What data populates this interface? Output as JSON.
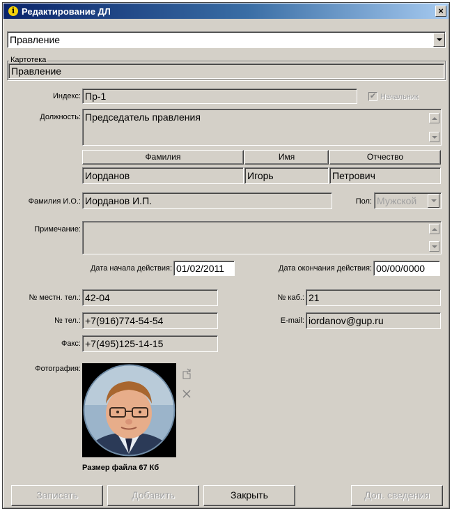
{
  "window": {
    "title": "Редактирование ДЛ",
    "close": "×"
  },
  "top_select": {
    "value": "Правление"
  },
  "kartoteka": {
    "caption": "Картотека",
    "value": "Правление"
  },
  "index": {
    "label": "Индекс:",
    "value": "Пр-1"
  },
  "chief": {
    "label": "Начальник",
    "checked": true,
    "check_mark": "✔"
  },
  "position": {
    "label": "Должность:",
    "value": "Председатель правления"
  },
  "name_headers": {
    "last": "Фамилия",
    "first": "Имя",
    "middle": "Отчество"
  },
  "name_values": {
    "last": "Иорданов",
    "first": "Игорь",
    "middle": "Петрович"
  },
  "short_name": {
    "label": "Фамилия И.О.:",
    "value": "Иорданов И.П."
  },
  "gender": {
    "label": "Пол:",
    "value": "Мужской"
  },
  "note": {
    "label": "Примечание:",
    "value": ""
  },
  "date_start": {
    "label": "Дата начала действия:",
    "value": "01/02/2011"
  },
  "date_end": {
    "label": "Дата окончания действия:",
    "value": "00/00/0000"
  },
  "local_phone": {
    "label": "№ местн. тел.:",
    "value": "42-04"
  },
  "room": {
    "label": "№ каб.:",
    "value": "21"
  },
  "phone": {
    "label": "№ тел.:",
    "value": "+7(916)774-54-54"
  },
  "email": {
    "label": "E-mail:",
    "value": "iordanov@gup.ru"
  },
  "fax": {
    "label": "Факс:",
    "value": "+7(495)125-14-15"
  },
  "photo": {
    "label": "Фотография:",
    "size_text": "Размер файла 67 Кб",
    "icons": [
      "open-file-icon",
      "delete-icon"
    ]
  },
  "buttons": {
    "save": "Записать",
    "add": "Добавить",
    "close": "Закрыть",
    "extra": "Доп. сведения"
  },
  "colors": {
    "face": "#d4d0c8",
    "title_start": "#0a246a",
    "title_end": "#a6caf0",
    "disabled_text": "#a0a0a0"
  }
}
